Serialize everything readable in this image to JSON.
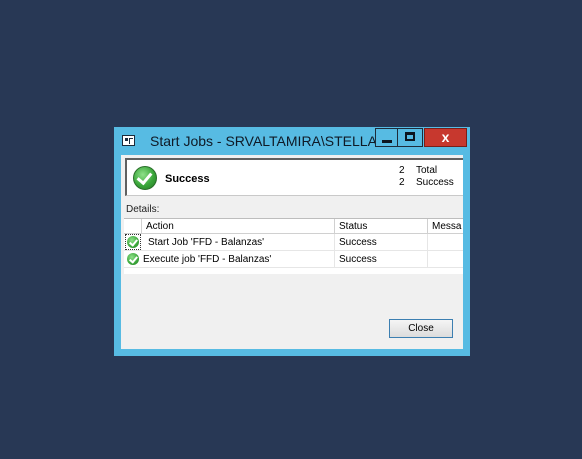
{
  "window": {
    "title": "Start Jobs - SRVALTAMIRA\\STELLAR",
    "controls": {
      "minimize_icon": "minimize-icon",
      "maximize_icon": "maximize-icon",
      "close_glyph": "x"
    }
  },
  "summary": {
    "status": "Success",
    "total_count": "2",
    "total_label": "Total",
    "success_count": "2",
    "success_label": "Success",
    "icon": "success-check-icon"
  },
  "details": {
    "label": "Details:",
    "columns": [
      "Action",
      "Status",
      "Messa"
    ],
    "rows": [
      {
        "action": "Start Job 'FFD - Balanzas'",
        "status": "Success",
        "message": ""
      },
      {
        "action": "Execute job 'FFD - Balanzas'",
        "status": "Success",
        "message": ""
      }
    ]
  },
  "buttons": {
    "close": "Close"
  },
  "colors": {
    "desktop": "#283855",
    "frame": "#57bbe3",
    "close_button": "#c7382e",
    "success": "#3aa63a"
  }
}
